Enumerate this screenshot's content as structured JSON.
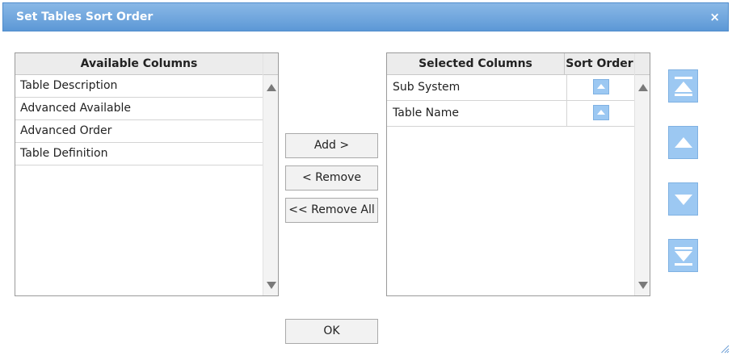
{
  "dialog": {
    "title": "Set Tables Sort Order",
    "close_glyph": "×"
  },
  "available": {
    "header": "Available Columns",
    "items": [
      "Table Description",
      "Advanced Available",
      "Advanced Order",
      "Table Definition"
    ]
  },
  "selected": {
    "header_name": "Selected Columns",
    "header_sort": "Sort Order",
    "items": [
      "Sub System",
      "Table Name"
    ]
  },
  "buttons": {
    "add": "Add >",
    "remove": "< Remove",
    "remove_all": "<< Remove All",
    "ok": "OK"
  },
  "side_icons": [
    "move-top-icon",
    "move-up-icon",
    "move-down-icon",
    "move-bottom-icon"
  ],
  "colors": {
    "title_bar": "#5c98d6",
    "accent_button": "#9cc8f2"
  }
}
